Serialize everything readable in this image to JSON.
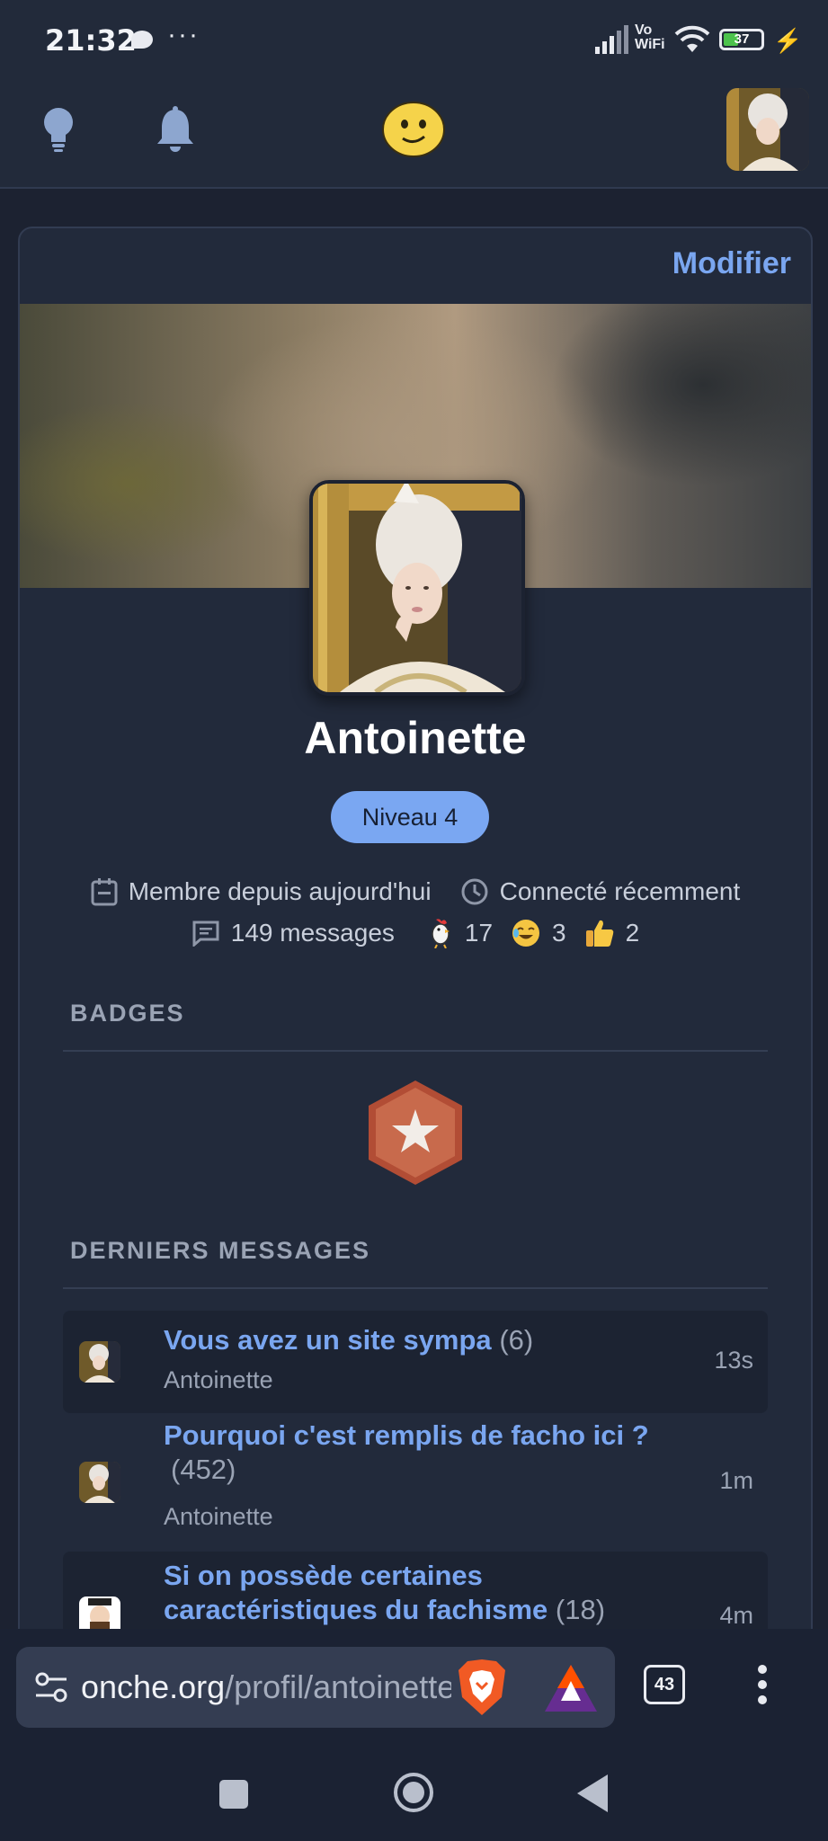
{
  "status_bar": {
    "time": "21:32",
    "vo": "Vo",
    "wifi": "WiFi",
    "battery": "37"
  },
  "top_nav": {
    "icons": [
      "lightbulb-icon",
      "bell-icon",
      "smiley-logo-icon",
      "avatar"
    ]
  },
  "profile": {
    "edit_label": "Modifier",
    "username": "Antoinette",
    "level": "Niveau 4",
    "member_since": "Membre depuis aujourd'hui",
    "last_seen": "Connecté récemment",
    "messages": "149 messages",
    "reactions": [
      {
        "icon": "rooster-icon",
        "count": "17"
      },
      {
        "icon": "laughing-emoji-icon",
        "count": "3"
      },
      {
        "icon": "thumbs-up-icon",
        "count": "2"
      }
    ]
  },
  "badges": {
    "title": "BADGES"
  },
  "recent": {
    "title": "DERNIERS MESSAGES",
    "items": [
      {
        "title": "Vous avez un site sympa",
        "count": "(6)",
        "author": "Antoinette",
        "time": "13s"
      },
      {
        "title": "Pourquoi c'est remplis de facho ici ?",
        "count": "(452)",
        "author": "Antoinette",
        "time": "1m"
      },
      {
        "title_line1": "Si on possède certaines",
        "title_line2": "caractéristiques du fachisme",
        "count": "(18)",
        "time": "4m"
      }
    ]
  },
  "browser": {
    "url_domain": "onche.org",
    "url_path": "/profil/antoinette",
    "tab_count": "43"
  },
  "colors": {
    "background": "#1c2231",
    "card": "#222a3b",
    "accent": "#7aa6f0",
    "level_badge": "#7aa7f2"
  }
}
